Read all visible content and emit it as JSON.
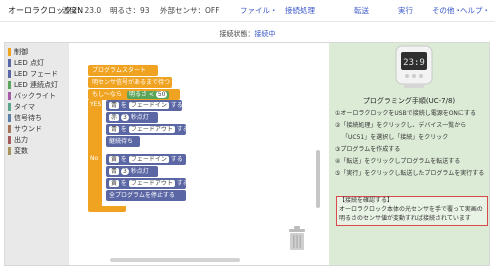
{
  "app": {
    "title": "オーロラクロック2N",
    "temperature": "温度：23.0",
    "brightness": "明るさ：93",
    "external_sensor": "外部センサ：OFF"
  },
  "menu": {
    "file": "ファイル・",
    "connect": "接続処理",
    "transfer": "転送",
    "run": "実行",
    "other": "その他・",
    "help": "ヘルプ・"
  },
  "connection": {
    "label": "接続状態：",
    "value": "接続中"
  },
  "toolbox": {
    "categories": [
      {
        "label": "制御",
        "color": "#f0a321"
      },
      {
        "label": "LED 点灯",
        "color": "#5b67a5"
      },
      {
        "label": "LED フェード",
        "color": "#5b67a5"
      },
      {
        "label": "LED 連続点灯",
        "color": "#5ba55b"
      },
      {
        "label": "バックライト",
        "color": "#a55ba5"
      },
      {
        "label": "タイマ",
        "color": "#5ba58a"
      },
      {
        "label": "信号待ち",
        "color": "#5b80a5"
      },
      {
        "label": "サウンド",
        "color": "#a5745b"
      },
      {
        "label": "出力",
        "color": "#a55b5b"
      },
      {
        "label": "変数",
        "color": "#a5955b"
      }
    ]
  },
  "blocks": {
    "start": "プログラムスタート",
    "wait_signal": "明センサ信号があるまで待つ",
    "if_label": "もし～なら",
    "brightness": "明るさ",
    "compare": "<",
    "threshold": "50",
    "yes": "YES",
    "no": "No",
    "c1_color": "青",
    "c1_action": "フェードイン",
    "c1_suffix": "する",
    "c2_color": "赤",
    "c2_num": "3",
    "c2_action": "秒点灯",
    "c3_color": "青",
    "c3_action": "フェードアウト",
    "c3_suffix": "する",
    "c4": "継続待ち",
    "n1_color": "黄",
    "n1_action": "フェードイン",
    "n1_suffix": "する",
    "n2_color": "青",
    "n2_num": "3",
    "n2_action": "秒点灯",
    "n3_color": "黄",
    "n3_action": "フェードアウト",
    "n3_suffix": "する",
    "n4": "全プログラムを停止する"
  },
  "panel": {
    "device_display": "23:9",
    "title": "プログラミング手順(UC-7/8)",
    "steps": [
      "①オーロラクロックをUSBで接続し電源をONにする",
      "②「接続処理」をクリックし、デバイス一覧から",
      "「UC51」を選択し「接続」をクリック",
      "③プログラムを作成する",
      "④「転送」をクリックしプログラムを転送する",
      "⑤「実行」をクリックし転送したプログラムを実行する"
    ],
    "note": [
      "【接続を確認する】",
      "オーロラクロック本体の光センサを手で覆って実画の",
      "明るさのセンサ値が変動すれば接続されています"
    ]
  }
}
